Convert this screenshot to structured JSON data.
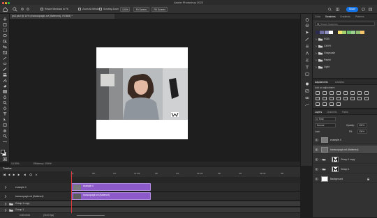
{
  "window": {
    "title": "Adobe Photoshop 2023"
  },
  "options_bar": {
    "resize_windows_label": "Resize Windows to Fit",
    "zoom_all_label": "Zoom All Windows",
    "scrubby_zoom_label": "Scrubby Zoom",
    "zoom_value": "100%",
    "fit_screen_label": "Fit Screen",
    "fill_screen_label": "Fill Screen",
    "share_label": "Share"
  },
  "document": {
    "tab_label": "ps4.psd @ 14% (transcopagtr-xvl (flattened), RGB/8) *"
  },
  "status_bar": {
    "zoom": "14.53%",
    "efficiency": "Efficiency: 100%*"
  },
  "panels": {
    "swatches": {
      "tabs": [
        "Color",
        "Swatches",
        "Gradients",
        "Patterns"
      ],
      "active_tab": "Swatches",
      "search_placeholder": "Search Swatches",
      "colors": [
        "#2b2b4d",
        "#6f6fa3",
        "#8f8fbf",
        "#ffffff",
        "#2a2a2a",
        "#f5e26a",
        "#a6d16f",
        "#6fbf6f",
        "#9fcf8f",
        "#8fbf6f",
        "#f5c66a"
      ],
      "folders": [
        "RGB",
        "CMYK",
        "Grayscale",
        "Pastel",
        "Light"
      ]
    },
    "adjustments": {
      "tabs": [
        "Adjustments",
        "Libraries"
      ],
      "heading": "Add an adjustment"
    },
    "layers": {
      "tabs": [
        "Layers",
        "Channels",
        "Paths"
      ],
      "filter_label": "Kind",
      "blend_mode": "Normal",
      "opacity_label": "Opacity:",
      "opacity_value": "100%",
      "lock_label": "Lock:",
      "fill_label": "Fill:",
      "fill_value": "100%",
      "items": [
        {
          "name": "example 4",
          "selected": false
        },
        {
          "name": "transcopagtr-xvl (flattened)",
          "selected": true
        },
        {
          "name": "Group 1 copy",
          "selected": false
        },
        {
          "name": "Group 1",
          "selected": false
        },
        {
          "name": "Background",
          "selected": false
        }
      ]
    }
  },
  "timeline": {
    "title": "Timeline",
    "ruler_ticks": [
      "00",
      "05f",
      "10f",
      "01:00f",
      "05f",
      "10f",
      "02:00f",
      "05f",
      "10f",
      "03:00f",
      "05f"
    ],
    "tracks": [
      {
        "name": "example 4",
        "clip_label": "example 4"
      },
      {
        "name": "transcopagtr-xvl (flattened)",
        "clip_label": "transcopagtr-xvl (flattened)"
      }
    ],
    "groups": [
      "Group 1 copy",
      "Group 1"
    ],
    "current_time": "0:00:00:00",
    "frame_rate": "(30.00 fps)"
  },
  "accent": "#1473e6",
  "clip_color": "#8d5bc9"
}
